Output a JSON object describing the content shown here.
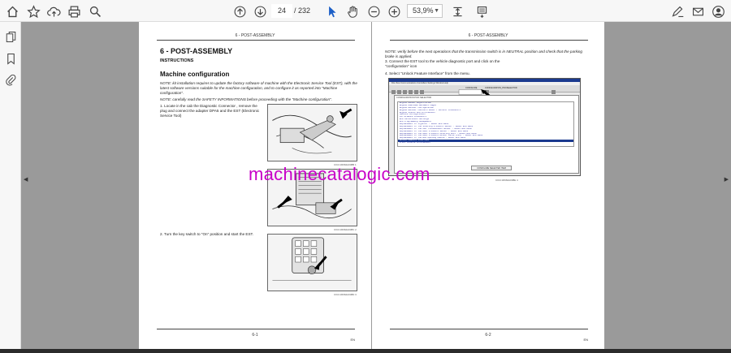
{
  "toolbar": {
    "page_current": "24",
    "page_total": "/ 232",
    "zoom": "53,9%"
  },
  "page1": {
    "running_head": "6 - POST-ASSEMBLY",
    "title": "6 - POST-ASSEMBLY",
    "subtitle": "INSTRUCTIONS",
    "section": "Machine configuration",
    "note1": "NOTE: kit installation requires to update the factory software of machine with the Electronic Service Tool (EST), with the latest software versions suitable for the machine configuration, and to configure it as reported into \"Machine configuration\".",
    "note2": "NOTE: carefully read the SAFETY INFORMATIONS before proceeding with the \"Machine configuration\".",
    "step1": "1.   Locate in the cab the Diagnostic Connector , remove the plug and connect the adapter DPA5 and the EST (Electronic Service Tool)",
    "step2": "2.   Turn the key switch to \"On\" position and start the EST.",
    "fig_caps": [
      "CICC19N62A038B   1",
      "CICC19N62A038C   2",
      "CICC19N62A038D   3"
    ],
    "page_number": "6-1",
    "lang": "EN"
  },
  "page2": {
    "running_head": "6 - POST-ASSEMBLY",
    "note": "NOTE: verify before the next operations that the transmission switch is in NEUTRAL position and check that the parking brake is applied.",
    "step3": "3.   Connect the EST tool to the vehicle diagnostic port and click on the \"configuration\" icon",
    "step4": "4.   Select \"Unlock Feature Interface\" from the menu.",
    "fig_cap": "CICC19N62A038E   4",
    "page_number": "6-2",
    "lang": "EN"
  },
  "est_screen": {
    "menu": "File  View  Communications  Controllers  Settings  Window  Help",
    "panel_header": "CONFIGURATION PICK SELECTOR",
    "field_label": "CONFIGURE",
    "field_value": "CONFIGURATION_PICKSELECTOR",
    "items": [
      "Engine Reboot Registration",
      "Engine Download Hardware Pages",
      "Engine Recover Configuration",
      "Engine Recover Counters Reset / Default Indicators",
      "Engine Status And Information",
      "Machine Configuration",
      "Performance Indicators",
      "ECU Calibration Settings",
      "ECU Programming Management",
      "Replacement of Injector - Reset ECU Data",
      "Replacement of the Steering Pressure Sensor - Reset ECU Data",
      "Replacement of the Max Transmission Sensor - Reset ECU Data",
      "Replacement of the Rail Pressure Sensor - Reset ECU Data",
      "Replacement of the Rail Pressure Metering Unit - Reset ECU Data",
      "Replacement of the Rail Pressure Relief Valve (PRV) - Reset ECU Data",
      "Replacement of the ECU Opening Module - Reset ECU Data",
      "Unlock Feature Interface",
      "Print Vehicle Information"
    ],
    "selected_index": 16,
    "button_label": "CONFIGURE SELECTED ITEM"
  },
  "watermark": "machinecatalogic.com"
}
